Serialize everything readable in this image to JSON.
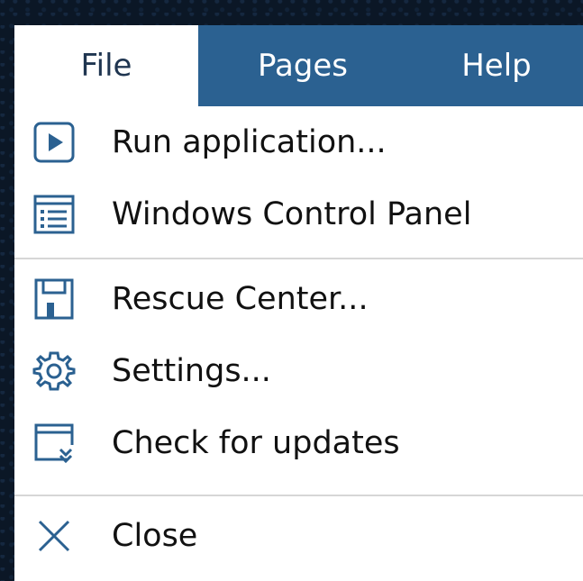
{
  "menubar": {
    "tabs": [
      {
        "label": "File"
      },
      {
        "label": "Pages"
      },
      {
        "label": "Help"
      }
    ]
  },
  "menu": {
    "items": [
      {
        "label": "Run application...",
        "icon": "run-icon"
      },
      {
        "label": "Windows Control Panel",
        "icon": "control-panel-icon"
      },
      {
        "label": "Rescue Center...",
        "icon": "floppy-disk-icon"
      },
      {
        "label": "Settings...",
        "icon": "gear-icon"
      },
      {
        "label": "Check for updates",
        "icon": "updates-icon"
      },
      {
        "label": "Close",
        "icon": "close-icon"
      }
    ]
  },
  "colors": {
    "menubar": "#2b6191",
    "accent": "#2b6191",
    "active_tab_bg": "#ffffff",
    "separator": "#d6d6d6"
  }
}
